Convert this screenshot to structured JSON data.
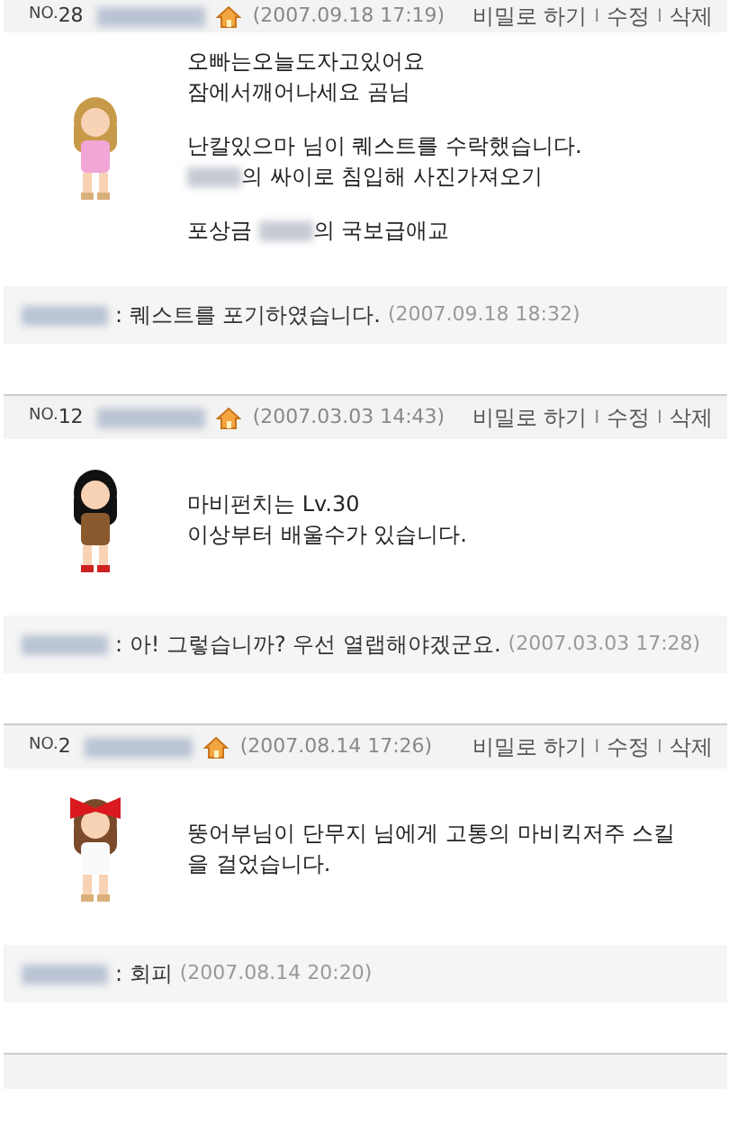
{
  "posts": [
    {
      "no_label": "NO.",
      "number": "28",
      "date": "(2007.09.18 17:19)",
      "actions": [
        "비밀로 하기",
        "수정",
        "삭제"
      ],
      "separators": [
        "I",
        "I"
      ],
      "paragraphs": [
        [
          [
            {
              "text": "오빠는오늘도자고있어요"
            }
          ],
          [
            {
              "text": "잠에서깨어나세요 곰님"
            }
          ]
        ],
        [
          [
            {
              "text": "난칼있으마 님이 퀘스트를 수락했습니다."
            }
          ],
          [
            {
              "kind": "redacted"
            },
            {
              "text": "의 싸이로 침입해 사진가져오기"
            }
          ]
        ],
        [
          [
            {
              "text": "포상금 "
            },
            {
              "kind": "redacted"
            },
            {
              "text": "의 국보급애교"
            }
          ]
        ]
      ],
      "reply": {
        "colon": ":",
        "text": "퀘스트를 포기하였습니다.",
        "date": "(2007.09.18 18:32)"
      }
    },
    {
      "no_label": "NO.",
      "number": "12",
      "date": "(2007.03.03 14:43)",
      "actions": [
        "비밀로 하기",
        "수정",
        "삭제"
      ],
      "separators": [
        "I",
        "I"
      ],
      "paragraphs": [
        [
          [
            {
              "text": "마비펀치는 Lv.30"
            }
          ],
          [
            {
              "text": "이상부터 배울수가 있습니다."
            }
          ]
        ]
      ],
      "reply": {
        "colon": ":",
        "text": "아! 그렇습니까? 우선 열랩해야겠군요.",
        "date": "(2007.03.03 17:28)"
      }
    },
    {
      "no_label": "NO.",
      "number": "2",
      "date": "(2007.08.14 17:26)",
      "actions": [
        "비밀로 하기",
        "수정",
        "삭제"
      ],
      "separators": [
        "I",
        "I"
      ],
      "paragraphs": [
        [
          [
            {
              "text": "뚱어부님이 단무지 님에게 고통의 마비킥저주 스킬 을 걸었습니다."
            }
          ]
        ]
      ],
      "reply": {
        "colon": ":",
        "text": "회피",
        "date": "(2007.08.14 20:20)"
      }
    }
  ]
}
